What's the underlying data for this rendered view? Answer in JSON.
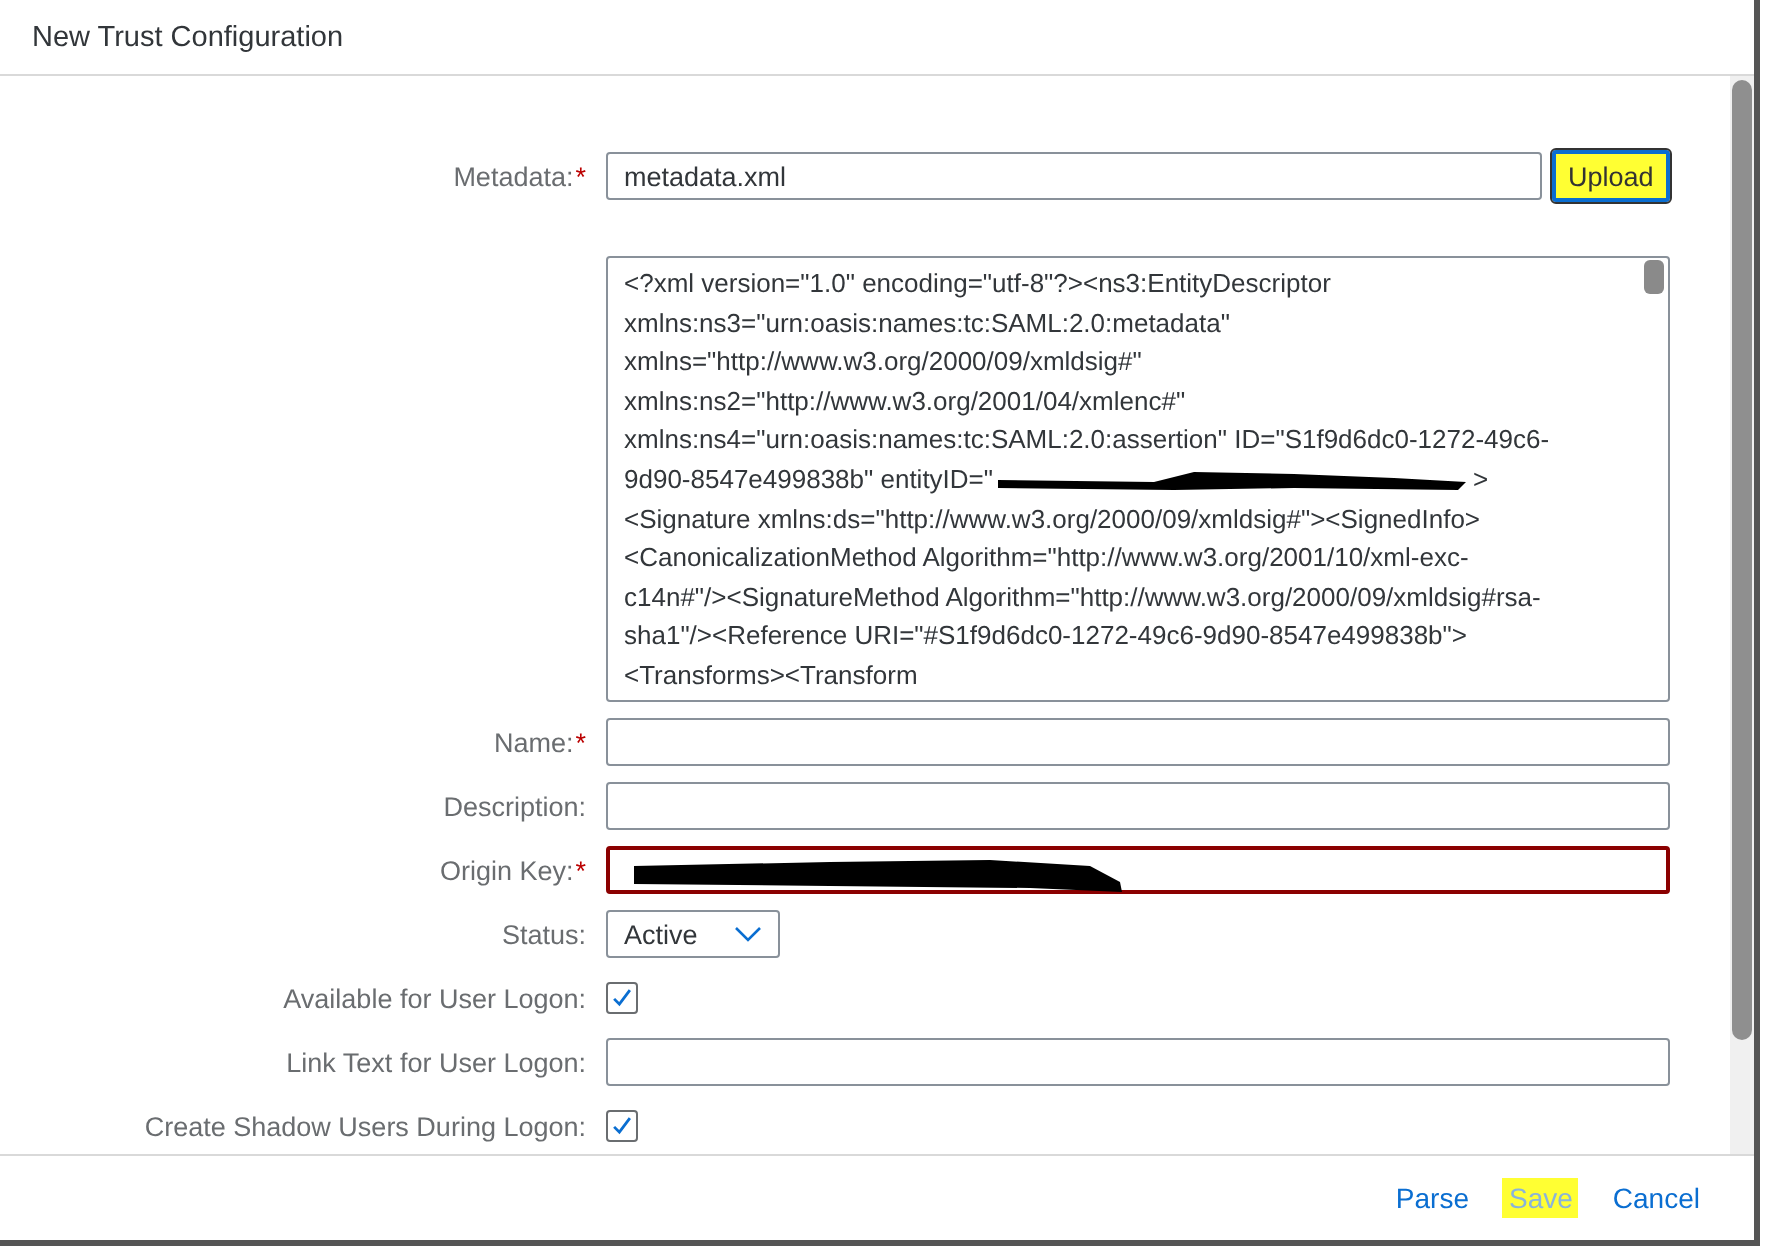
{
  "window": {
    "title": "New Trust Configuration"
  },
  "fields": [
    {
      "kind": "file",
      "label": "Metadata:",
      "required_mark": "*",
      "value": "metadata.xml",
      "button": {
        "label": "Upload",
        "highlighted": true
      }
    },
    {
      "kind": "textarea",
      "lines": [
        {
          "text": "<?xml version=\"1.0\" encoding=\"utf-8\"?><ns3:EntityDescriptor"
        },
        {
          "text": "xmlns:ns3=\"urn:oasis:names:tc:SAML:2.0:metadata\""
        },
        {
          "text": "xmlns=\"http://www.w3.org/2000/09/xmldsig#\""
        },
        {
          "text": "xmlns:ns2=\"http://www.w3.org/2001/04/xmlenc#\""
        },
        {
          "text": "xmlns:ns4=\"urn:oasis:names:tc:SAML:2.0:assertion\" ID=\"S1f9d6dc0-1272-49c6-"
        },
        {
          "text": "9d90-8547e499838b\" entityID=\"",
          "redacted": true,
          "tail": ">"
        },
        {
          "text": "<Signature xmlns:ds=\"http://www.w3.org/2000/09/xmldsig#\"><SignedInfo>"
        },
        {
          "text": "<CanonicalizationMethod Algorithm=\"http://www.w3.org/2001/10/xml-exc-"
        },
        {
          "text": "c14n#\"/><SignatureMethod Algorithm=\"http://www.w3.org/2000/09/xmldsig#rsa-"
        },
        {
          "text": "sha1\"/><Reference URI=\"#S1f9d6dc0-1272-49c6-9d90-8547e499838b\">"
        },
        {
          "text": "<Transforms><Transform"
        }
      ]
    },
    {
      "kind": "text",
      "label": "Name:",
      "required_mark": "*",
      "error": false,
      "redacted": false
    },
    {
      "kind": "text",
      "label": "Description:",
      "error": false,
      "redacted": false
    },
    {
      "kind": "text",
      "label": "Origin Key:",
      "required_mark": "*",
      "error": true,
      "redacted": true
    },
    {
      "kind": "select",
      "label": "Status:",
      "value": "Active"
    },
    {
      "kind": "checkbox",
      "label": "Available for User Logon:",
      "checked": true
    },
    {
      "kind": "text",
      "label": "Link Text for User Logon:",
      "error": false,
      "redacted": false
    },
    {
      "kind": "checkbox",
      "label": "Create Shadow Users During Logon:",
      "checked": true
    }
  ],
  "footer_buttons": [
    {
      "label": "Parse",
      "disabled": false,
      "highlighted": false
    },
    {
      "label": "Save",
      "disabled": true,
      "highlighted": true
    },
    {
      "label": "Cancel",
      "disabled": false,
      "highlighted": false
    }
  ]
}
